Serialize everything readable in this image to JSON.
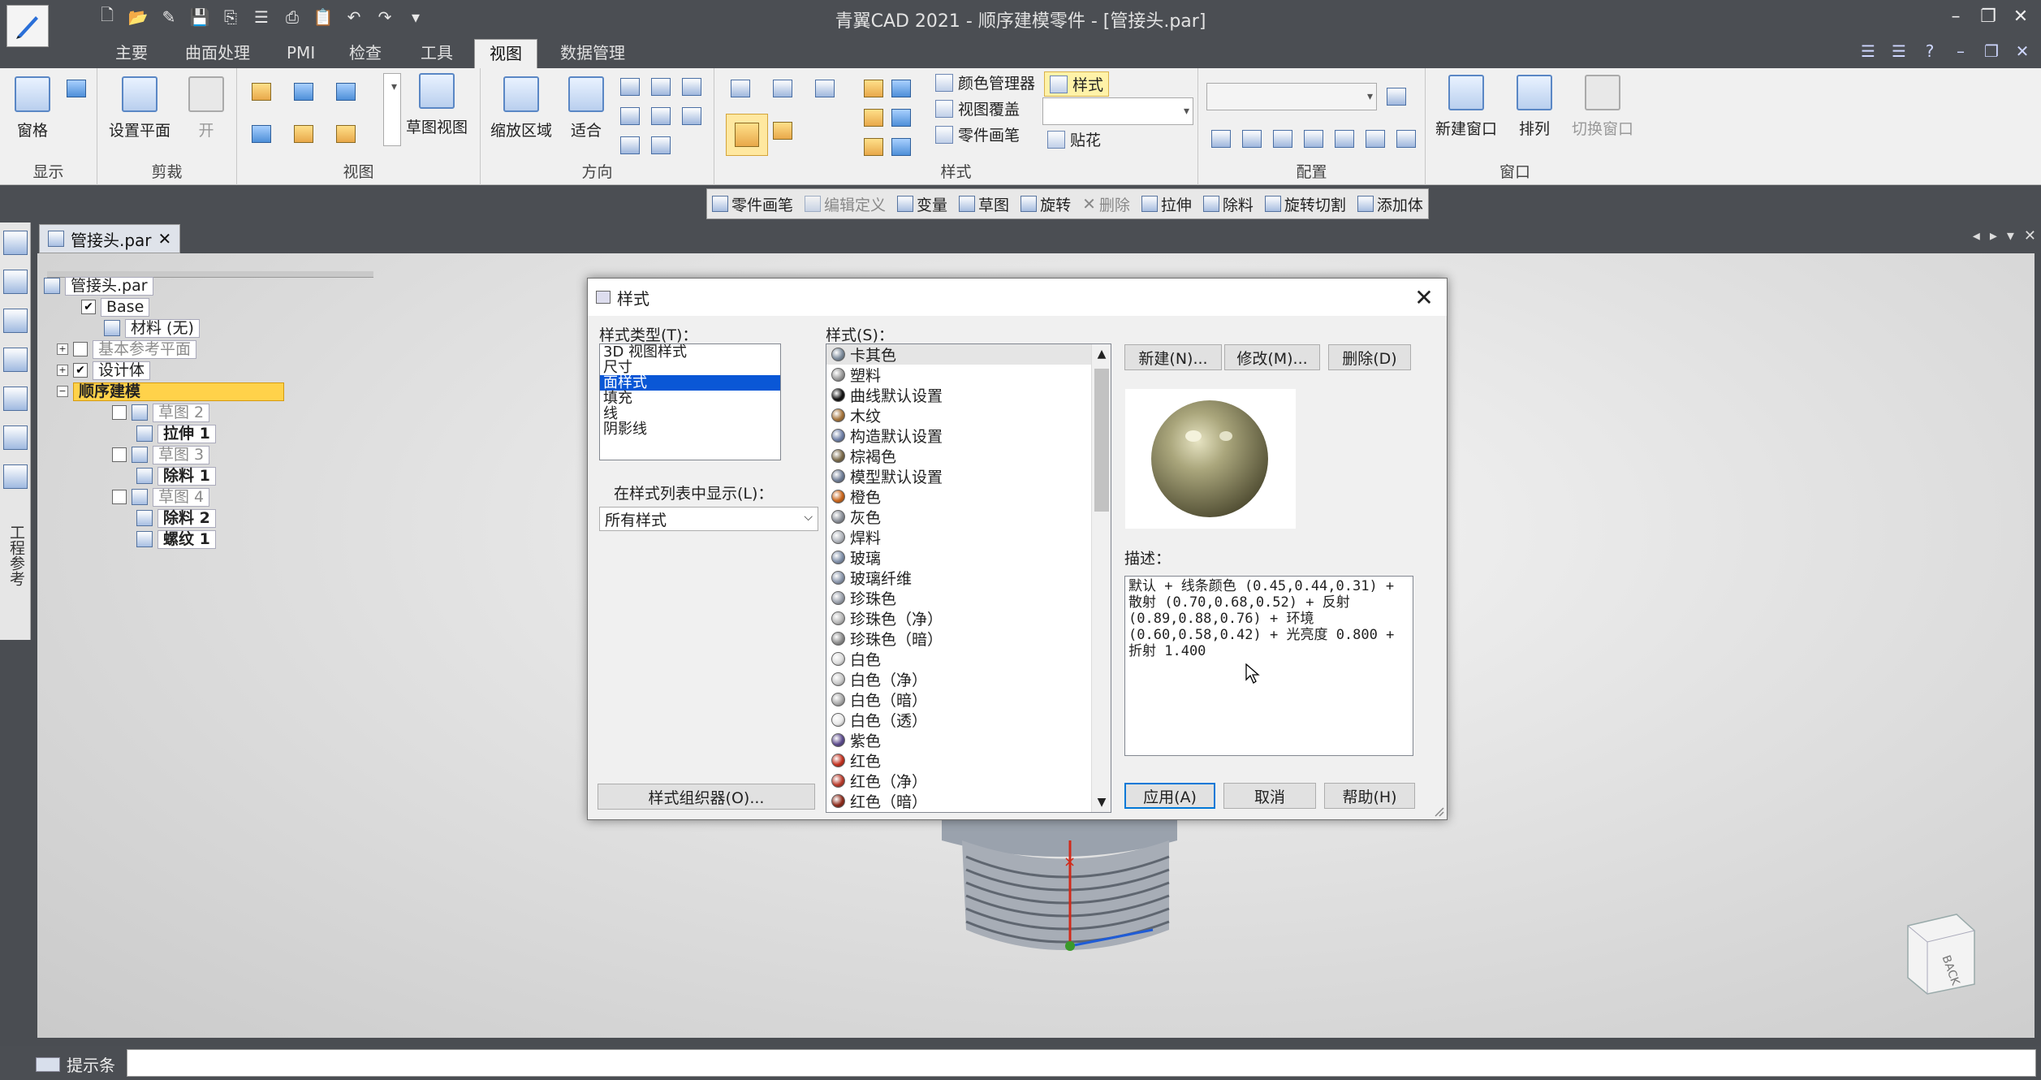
{
  "app": {
    "window_title": "青翼CAD 2021 - 顺序建模零件 - [管接头.par]",
    "tabs": [
      {
        "label": "主要"
      },
      {
        "label": "曲面处理"
      },
      {
        "label": "PMI"
      },
      {
        "label": "检查"
      },
      {
        "label": "工具"
      },
      {
        "label": "视图",
        "active": true
      },
      {
        "label": "数据管理"
      }
    ]
  },
  "ribbon": {
    "groups": {
      "display": "显示",
      "clip": "剪裁",
      "view": "视图",
      "orient": "方向",
      "style": "样式",
      "config": "配置",
      "window": "窗口"
    },
    "buttons": {
      "grid": "窗格",
      "set_plane": "设置平面",
      "open": "开",
      "sketch_view": "草图视图",
      "zoom_area": "缩放区域",
      "fit": "适合",
      "color_manager": "颜色管理器",
      "style": "样式",
      "view_overlay": "视图覆盖",
      "part_painter": "零件画笔",
      "decal": "贴花",
      "new_window": "新建窗口",
      "arrange": "排列",
      "switch_window": "切换窗口"
    }
  },
  "command_bar": [
    {
      "label": "零件画笔",
      "enabled": true
    },
    {
      "label": "编辑定义",
      "enabled": false
    },
    {
      "label": "变量",
      "enabled": true
    },
    {
      "label": "草图",
      "enabled": true
    },
    {
      "label": "旋转",
      "enabled": true
    },
    {
      "label": "删除",
      "enabled": false
    },
    {
      "label": "拉伸",
      "enabled": true
    },
    {
      "label": "除料",
      "enabled": true
    },
    {
      "label": "旋转切割",
      "enabled": true
    },
    {
      "label": "添加体",
      "enabled": true
    }
  ],
  "left_dock": {
    "label": "工程参考"
  },
  "document": {
    "tab_label": "管接头.par"
  },
  "tree": {
    "root": "管接头.par",
    "base": "Base",
    "material": "材料 (无)",
    "ref_planes": "基本参考平面",
    "design_body": "设计体",
    "ordered": "顺序建模",
    "sketch2": "草图 2",
    "extrude1": "拉伸 1",
    "sketch3": "草图 3",
    "cut1": "除料 1",
    "sketch4": "草图 4",
    "cut2": "除料 2",
    "thread1": "螺纹 1"
  },
  "dialog": {
    "title": "样式",
    "style_type_label": "样式类型(T)：",
    "style_types": [
      "3D 视图样式",
      "尺寸",
      "面样式",
      "填充",
      "线",
      "阴影线"
    ],
    "selected_type": "面样式",
    "styles_label": "样式(S)：",
    "styles": [
      {
        "name": "卡其色",
        "color": "#7b8a9a"
      },
      {
        "name": "塑料",
        "color": "#9a9a9a"
      },
      {
        "name": "曲线默认设置",
        "color": "#111111"
      },
      {
        "name": "木纹",
        "color": "#a4733a"
      },
      {
        "name": "构造默认设置",
        "color": "#6e7fa6"
      },
      {
        "name": "棕褐色",
        "color": "#7a6a4a"
      },
      {
        "name": "模型默认设置",
        "color": "#6f7d96"
      },
      {
        "name": "橙色",
        "color": "#c8641a"
      },
      {
        "name": "灰色",
        "color": "#8a8f98"
      },
      {
        "name": "焊料",
        "color": "#b0b4bb"
      },
      {
        "name": "玻璃",
        "color": "#7f8fa8"
      },
      {
        "name": "玻璃纤维",
        "color": "#8a96ab"
      },
      {
        "name": "珍珠色",
        "color": "#9aa0ab"
      },
      {
        "name": "珍珠色（净）",
        "color": "#b7b7b7"
      },
      {
        "name": "珍珠色（暗）",
        "color": "#8d8d8d"
      },
      {
        "name": "白色",
        "color": "#dcdcdc"
      },
      {
        "name": "白色（净）",
        "color": "#c9c9c9"
      },
      {
        "name": "白色（暗）",
        "color": "#a9a9a9"
      },
      {
        "name": "白色（透）",
        "color": "#e8e8e8"
      },
      {
        "name": "紫色",
        "color": "#5b4a8c"
      },
      {
        "name": "红色",
        "color": "#c2301e"
      },
      {
        "name": "红色（净）",
        "color": "#b83a2a"
      },
      {
        "name": "红色（暗）",
        "color": "#8c2a1a"
      }
    ],
    "filter_label": "在样式列表中显示(L)：",
    "filter_value": "所有样式",
    "organizer_button": "样式组织器(O)...",
    "new_button": "新建(N)...",
    "modify_button": "修改(M)...",
    "delete_button": "删除(D)",
    "desc_label": "描述：",
    "description": "默认 + 线条颜色 (0.45,0.44,0.31) +\n散射 (0.70,0.68,0.52) + 反射\n(0.89,0.88,0.76) + 环境\n(0.60,0.58,0.42) + 光亮度 0.800 +\n折射 1.400",
    "apply_button": "应用(A)",
    "cancel_button": "取消",
    "help_button": "帮助(H)",
    "preview_color": "#8e8a62"
  },
  "status": {
    "label": "提示条"
  },
  "viewcube": {
    "face_label": "BACK"
  }
}
